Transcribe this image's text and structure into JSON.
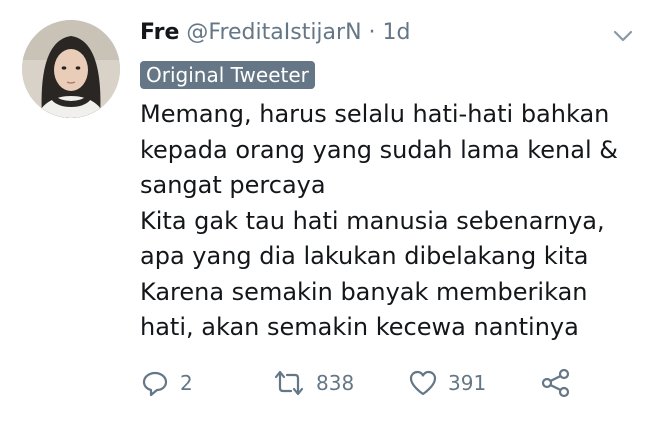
{
  "tweet": {
    "display_name": "Fre",
    "handle": "@FreditaIstijarN",
    "separator": "·",
    "time": "1d",
    "badge": "Original Tweeter",
    "lines": [
      "Memang, harus selalu hati-hati bahkan",
      "kepada orang yang sudah lama kenal &",
      "sangat percaya",
      "Kita gak tau hati manusia sebenarnya,",
      "apa yang dia lakukan dibelakang kita",
      "Karena semakin banyak memberikan",
      "hati, akan semakin kecewa nantinya"
    ],
    "actions": {
      "reply_count": "2",
      "retweet_count": "838",
      "like_count": "391"
    }
  },
  "icons": {
    "caret": "chevron-down-icon",
    "reply": "reply-icon",
    "retweet": "retweet-icon",
    "like": "heart-icon",
    "share": "share-icon"
  },
  "colors": {
    "text": "#14171a",
    "secondary": "#657786",
    "badge_bg": "#657786"
  }
}
